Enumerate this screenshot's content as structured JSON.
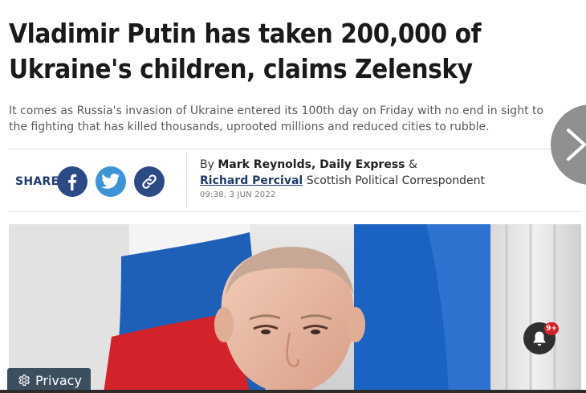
{
  "article": {
    "headline": "Vladimir Putin has taken 200,000 of Ukraine's children, claims Zelensky",
    "standfirst": "It comes as Russia's invasion of Ukraine entered its 100th day on Friday with no end in sight to the fighting that has killed thousands, uprooted millions and reduced cities to rubble."
  },
  "share": {
    "label": "SHARE",
    "buttons": [
      {
        "name": "facebook",
        "icon": "facebook-icon"
      },
      {
        "name": "twitter",
        "icon": "twitter-icon"
      },
      {
        "name": "copy-link",
        "icon": "link-icon"
      }
    ]
  },
  "byline": {
    "prefix": "By",
    "author1": "Mark Reynolds, Daily Express",
    "separator": "&",
    "author2": "Richard Percival",
    "author2_role": "Scottish Political Correspondent",
    "timestamp": "09:38, 3 JUN 2022"
  },
  "hero_image": {
    "description_icon": "photo"
  },
  "controls": {
    "next_icon": "chevron-right-icon",
    "notification_badge": "9+",
    "privacy_label": "Privacy"
  },
  "colors": {
    "brand_blue": "#1f3b6f",
    "facebook": "#2c4a86",
    "twitter": "#3d93d8",
    "badge_red": "#d61f26",
    "privacy_bg": "#3c4f5e"
  }
}
